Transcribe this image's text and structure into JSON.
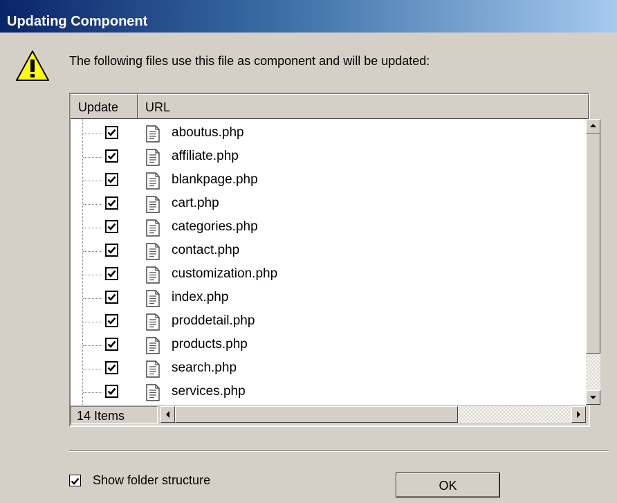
{
  "window": {
    "title": "Updating Component"
  },
  "message": "The following files use this file as component and will be updated:",
  "columns": {
    "update": "Update",
    "url": "URL"
  },
  "files": [
    {
      "name": "aboutus.php",
      "checked": true
    },
    {
      "name": "affiliate.php",
      "checked": true
    },
    {
      "name": "blankpage.php",
      "checked": true
    },
    {
      "name": "cart.php",
      "checked": true
    },
    {
      "name": "categories.php",
      "checked": true
    },
    {
      "name": "contact.php",
      "checked": true
    },
    {
      "name": "customization.php",
      "checked": true
    },
    {
      "name": "index.php",
      "checked": true
    },
    {
      "name": "proddetail.php",
      "checked": true
    },
    {
      "name": "products.php",
      "checked": true
    },
    {
      "name": "search.php",
      "checked": true
    },
    {
      "name": "services.php",
      "checked": true
    }
  ],
  "status": {
    "item_count": "14 Items"
  },
  "options": {
    "show_folder_structure_label": "Show folder structure",
    "show_folder_structure_checked": true
  },
  "buttons": {
    "ok": "OK"
  },
  "icons": {
    "warning": "warning-icon",
    "file": "php-file-icon",
    "check": "checkmark-icon"
  }
}
